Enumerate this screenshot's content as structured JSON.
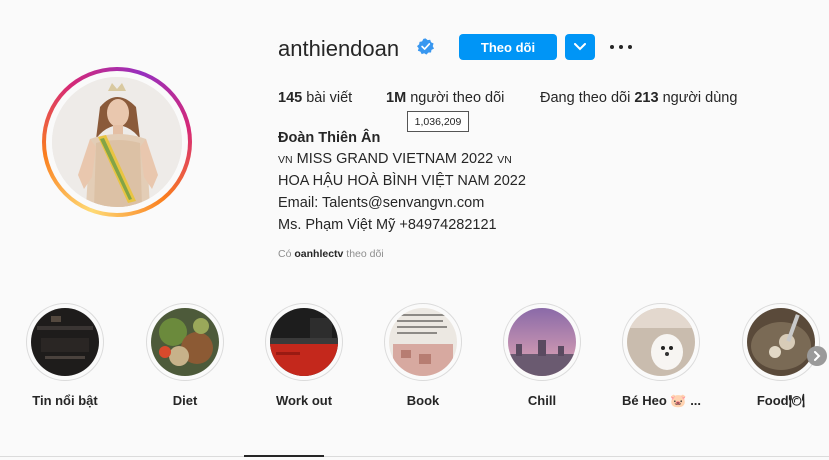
{
  "profile": {
    "username": "anthiendoan",
    "follow_label": "Theo dõi",
    "stats": {
      "posts_count": "145",
      "posts_label": "bài viết",
      "followers_count": "1M",
      "followers_label": "người theo dõi",
      "following_prefix": "Đang theo dõi",
      "following_count": "213",
      "following_suffix": "người dùng"
    },
    "followers_tooltip": "1,036,209",
    "bio": {
      "name": "Đoàn Thiên Ân",
      "line1_flag_a": "VN",
      "line1_text": "MISS GRAND VIETNAM 2022",
      "line1_flag_b": "VN",
      "line2": "HOA HẬU HOÀ BÌNH VIỆT NAM 2022",
      "line3": "Email: Talents@senvangvn.com",
      "line4": "Ms. Phạm Việt Mỹ +84974282121"
    },
    "followed_by_prefix": "Có",
    "followed_by_user": "oanhlectv",
    "followed_by_suffix": "theo dõi"
  },
  "highlights": [
    {
      "label": "Tin nổi bật"
    },
    {
      "label": "Diet"
    },
    {
      "label": "Work out"
    },
    {
      "label": "Book"
    },
    {
      "label": "Chill"
    },
    {
      "label": "Bé Heo 🐷 ..."
    },
    {
      "label": "Food🍽"
    }
  ],
  "colors": {
    "primary_button": "#0095f6",
    "text": "#262626",
    "secondary_text": "#8e8e8e",
    "background": "#fafafa"
  },
  "icons": [
    "verified-badge-icon",
    "chevron-down-icon",
    "more-options-icon",
    "chevron-right-icon"
  ]
}
